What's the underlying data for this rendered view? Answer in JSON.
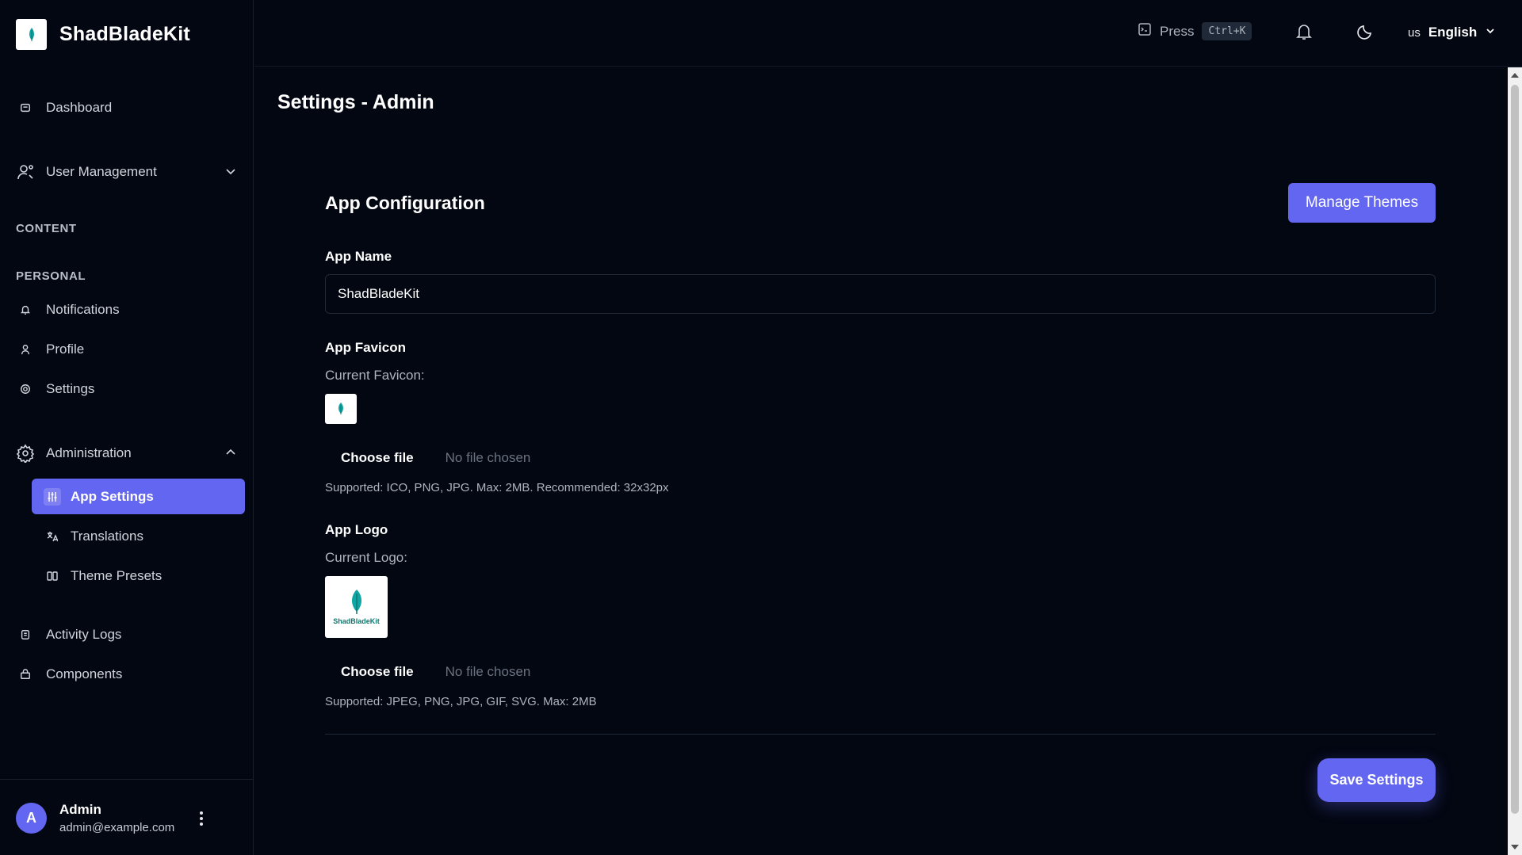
{
  "brand": {
    "name": "ShadBladeKit"
  },
  "sidebar": {
    "dashboard": "Dashboard",
    "user_management": "User Management",
    "section_content": "CONTENT",
    "section_personal": "PERSONAL",
    "notifications": "Notifications",
    "profile": "Profile",
    "settings": "Settings",
    "administration": "Administration",
    "admin_items": [
      {
        "label": "App Settings",
        "active": true
      },
      {
        "label": "Translations",
        "active": false
      },
      {
        "label": "Theme Presets",
        "active": false
      }
    ],
    "activity_logs": "Activity Logs",
    "components": "Components"
  },
  "user": {
    "initial": "A",
    "name": "Admin",
    "email": "admin@example.com"
  },
  "topbar": {
    "press_label": "Press",
    "shortcut": "Ctrl+K",
    "lang_flag": "us",
    "lang_label": "English"
  },
  "page": {
    "title": "Settings - Admin",
    "section_title": "App Configuration",
    "manage_themes": "Manage Themes",
    "app_name_label": "App Name",
    "app_name_value": "ShadBladeKit",
    "favicon_label": "App Favicon",
    "current_favicon": "Current Favicon:",
    "choose_file": "Choose file",
    "no_file": "No file chosen",
    "favicon_hint": "Supported: ICO, PNG, JPG. Max: 2MB. Recommended: 32x32px",
    "logo_label": "App Logo",
    "current_logo": "Current Logo:",
    "logo_text": "ShadBladeKit",
    "logo_hint": "Supported: JPEG, PNG, JPG, GIF, SVG. Max: 2MB",
    "save_settings": "Save Settings"
  },
  "colors": {
    "background": "#030712",
    "accent": "#6366f1",
    "border": "#1f2937",
    "muted_text": "#aeb3bd"
  }
}
